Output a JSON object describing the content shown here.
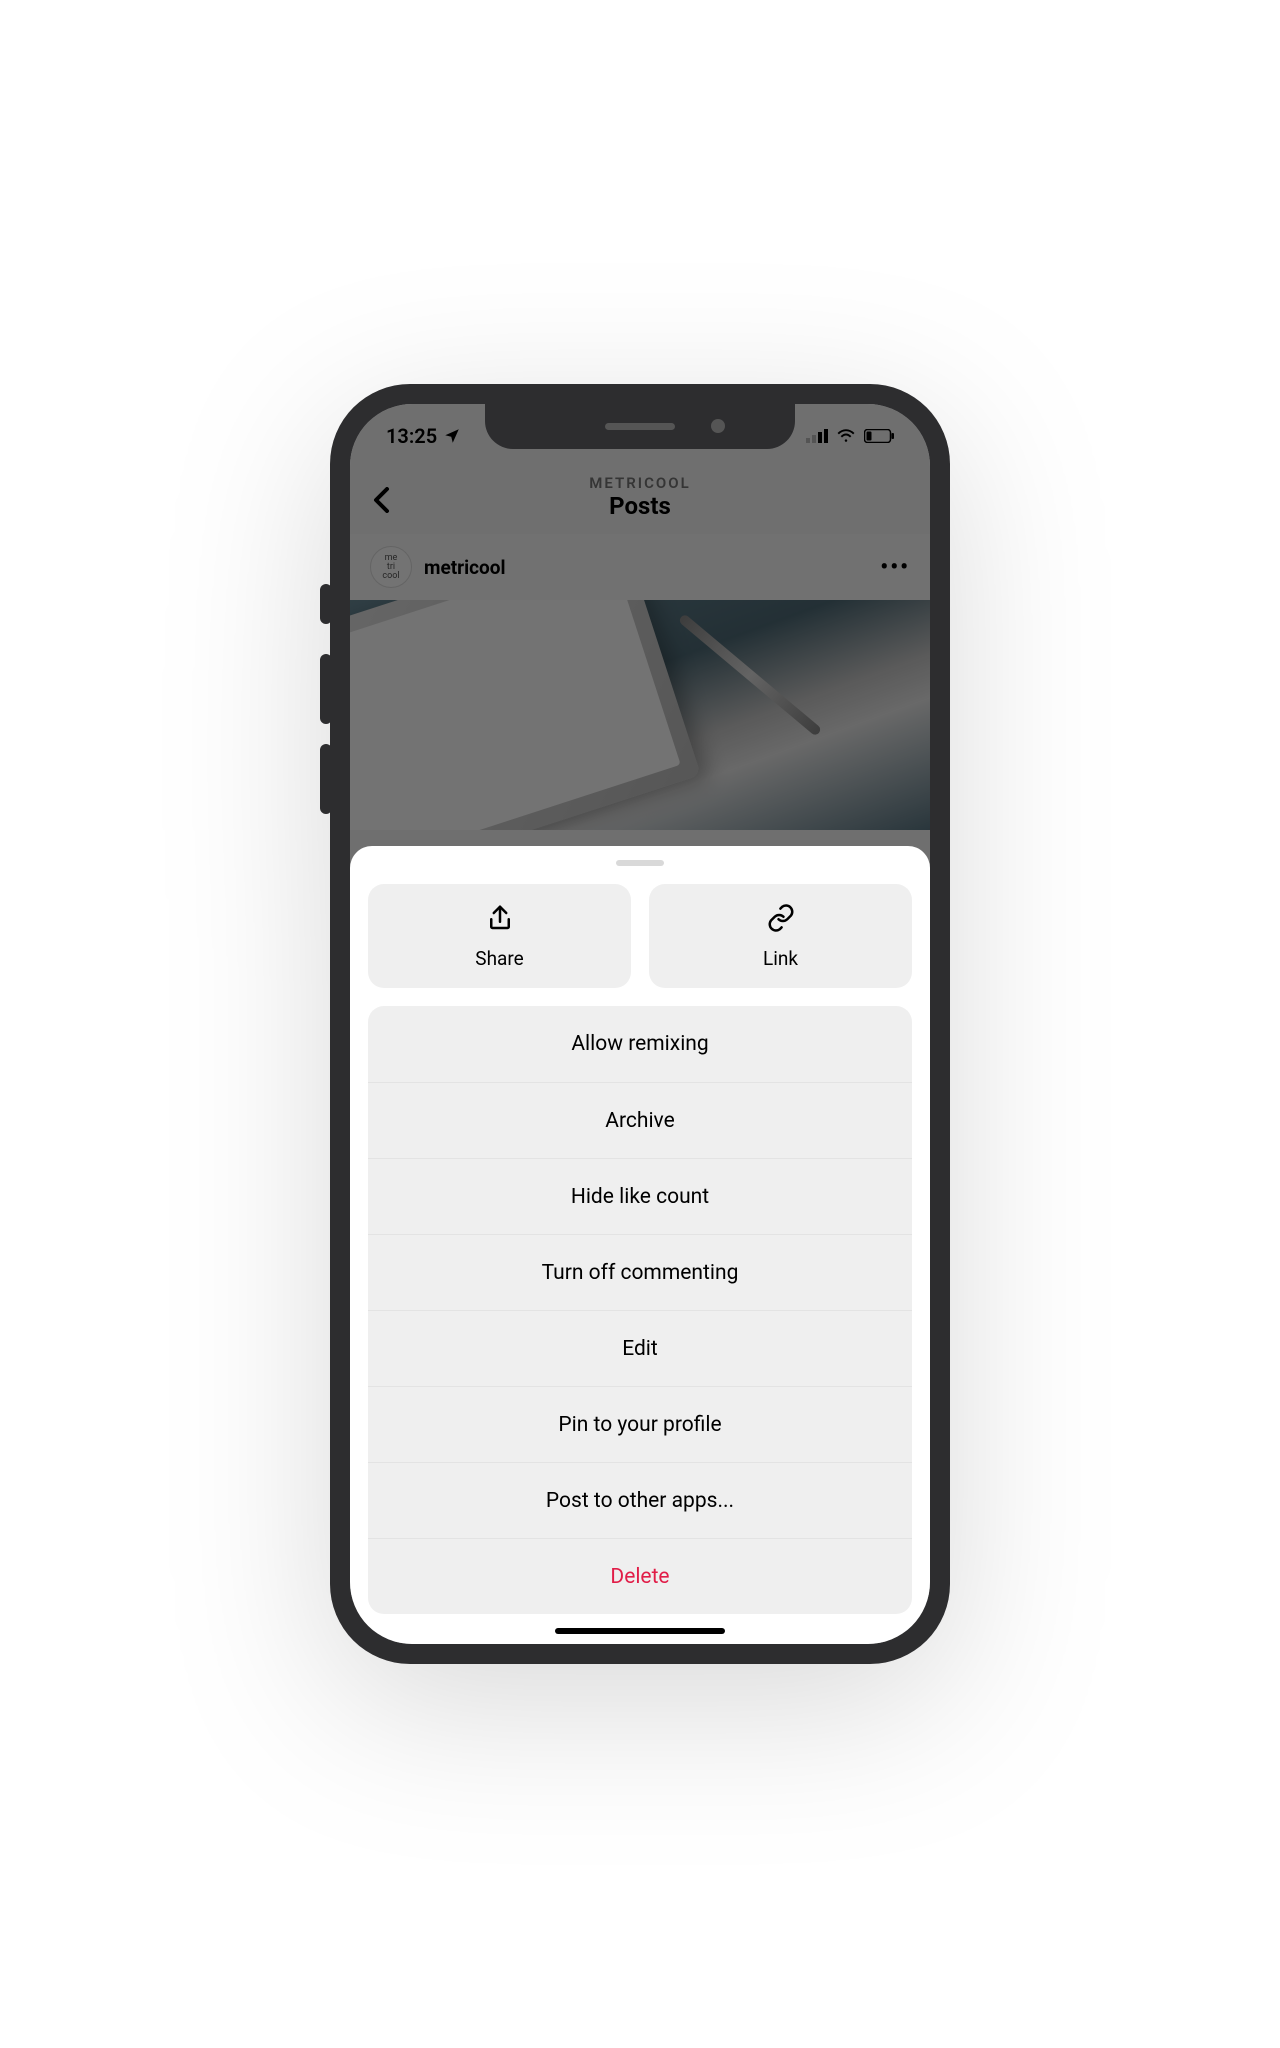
{
  "status": {
    "time": "13:25"
  },
  "header": {
    "app_name": "METRICOOL",
    "page_title": "Posts"
  },
  "post": {
    "avatar_lines": [
      "me",
      "tri",
      "cool"
    ],
    "username": "metricool"
  },
  "sheet": {
    "pills": [
      {
        "icon": "share-icon",
        "label": "Share"
      },
      {
        "icon": "link-icon",
        "label": "Link"
      }
    ],
    "items": [
      {
        "label": "Allow remixing",
        "danger": false
      },
      {
        "label": "Archive",
        "danger": false
      },
      {
        "label": "Hide like count",
        "danger": false
      },
      {
        "label": "Turn off commenting",
        "danger": false
      },
      {
        "label": "Edit",
        "danger": false
      },
      {
        "label": "Pin to your profile",
        "danger": false
      },
      {
        "label": "Post to other apps...",
        "danger": false
      },
      {
        "label": "Delete",
        "danger": true
      }
    ]
  }
}
